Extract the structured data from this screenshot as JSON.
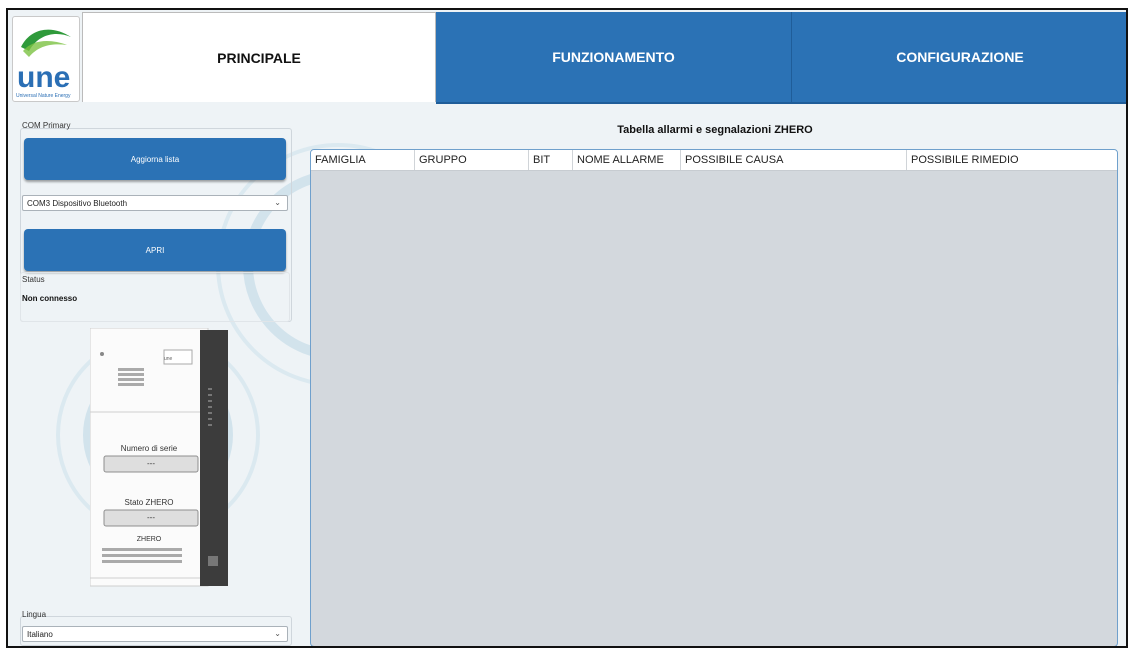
{
  "logo": {
    "brand": "une",
    "tagline": "Universal Nature Energy"
  },
  "tabs": [
    {
      "label": "PRINCIPALE",
      "active": true
    },
    {
      "label": "FUNZIONAMENTO",
      "active": false
    },
    {
      "label": "CONFIGURAZIONE",
      "active": false
    }
  ],
  "com_group": {
    "label": "COM Primary",
    "refresh_button": "Aggiorna lista",
    "port_select_value": "COM3 Dispositivo Bluetooth",
    "open_button": "APRI",
    "status_label": "Status",
    "status_value": "Non connesso"
  },
  "device": {
    "brand": "une",
    "serial_label": "Numero di serie",
    "serial_value": "---",
    "state_label": "Stato ZHERO",
    "state_value": "---",
    "model_label": "ZHERO"
  },
  "language": {
    "label": "Lingua",
    "value": "Italiano"
  },
  "alarms_table": {
    "title": "Tabella allarmi e segnalazioni ZHERO",
    "columns": [
      "FAMIGLIA",
      "GRUPPO",
      "BIT",
      "NOME ALLARME",
      "POSSIBILE CAUSA",
      "POSSIBILE RIMEDIO"
    ],
    "rows": []
  },
  "colors": {
    "accent": "#2b72b5",
    "table_bg": "#d3d8dd",
    "logo_green": "#2f9a3b",
    "logo_blue": "#2b6fb5"
  }
}
